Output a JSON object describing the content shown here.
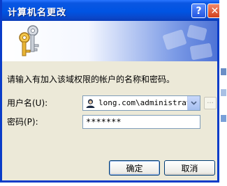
{
  "window": {
    "title": "计算机名更改",
    "help_glyph": "?",
    "close_glyph": "✕"
  },
  "dialog": {
    "instruction": "请输入有加入该域权限的帐户的名称和密码。",
    "username_label": "用户名(U):",
    "password_label": "密码(P):",
    "username_value": "long.com\\administrator",
    "password_mask": "*******",
    "browse_label": "..."
  },
  "buttons": {
    "ok": "确定",
    "cancel": "取消"
  },
  "icons": {
    "banner": "keys-icon",
    "user": "user-icon",
    "dropdown": "chevron-down-icon"
  }
}
